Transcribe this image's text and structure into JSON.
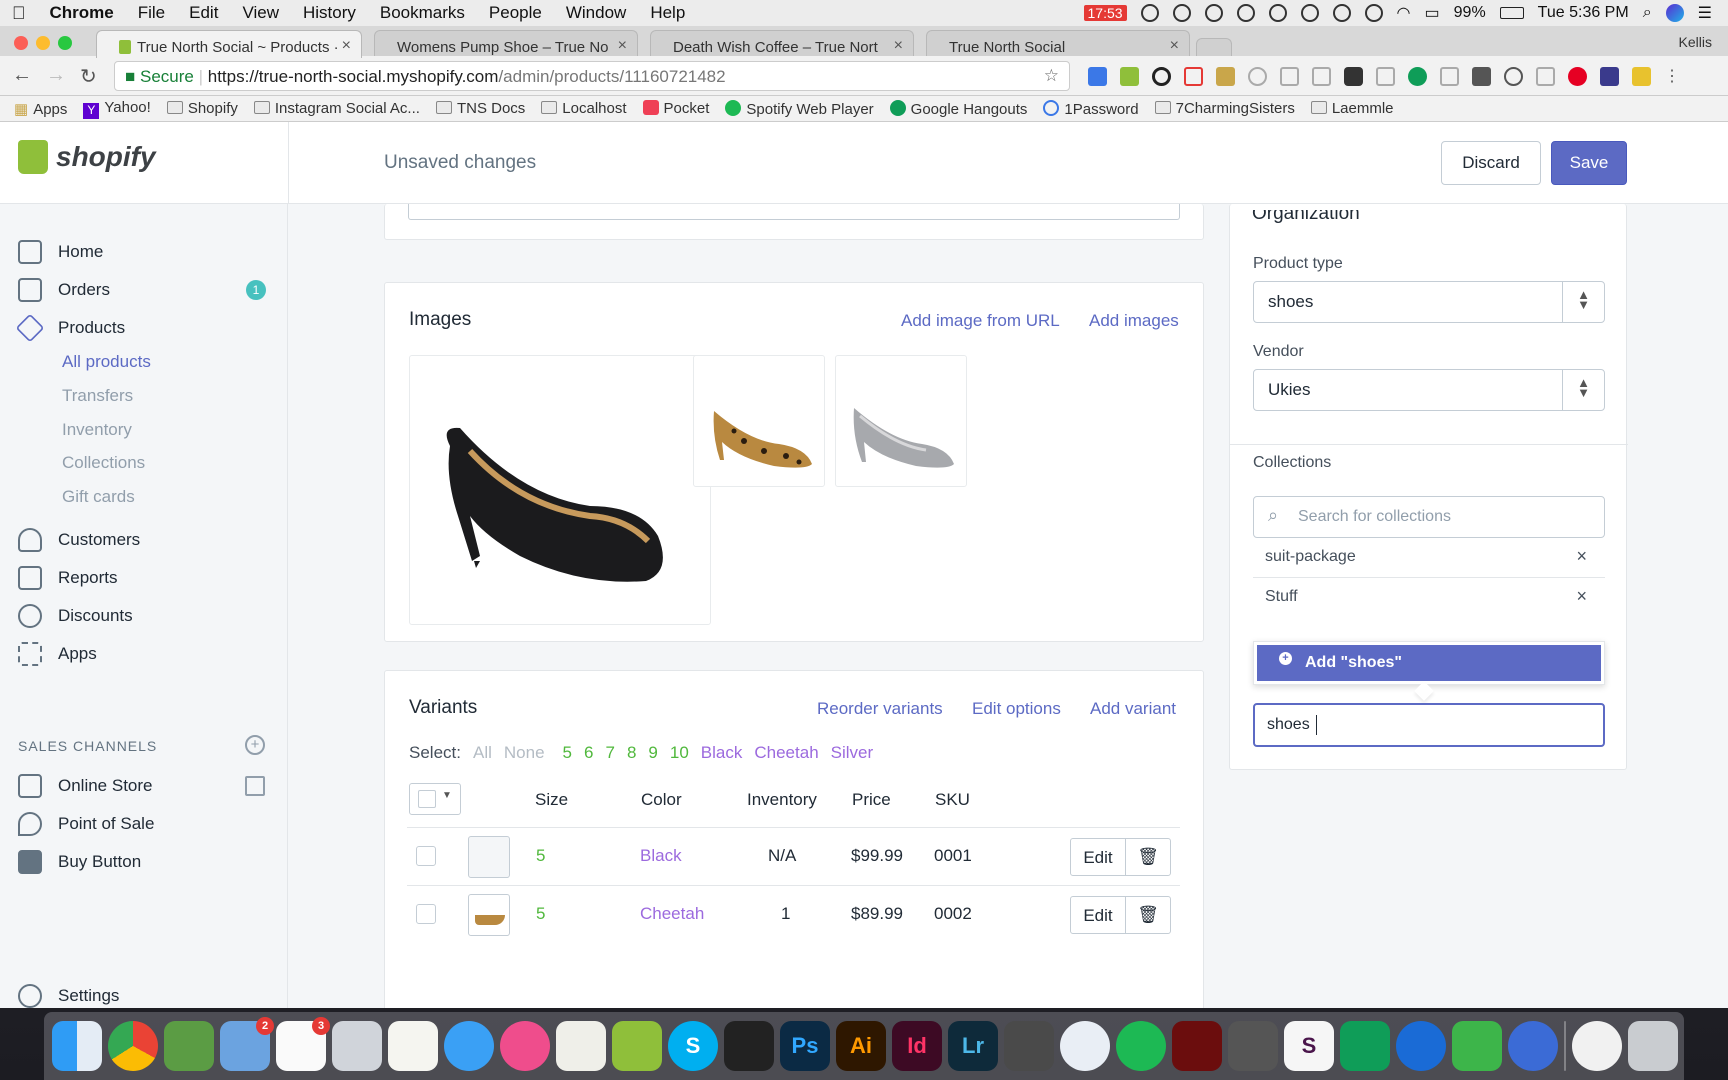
{
  "menubar": {
    "app": "Chrome",
    "menus": [
      "File",
      "Edit",
      "View",
      "History",
      "Bookmarks",
      "People",
      "Window",
      "Help"
    ],
    "record_time": "17:53",
    "battery": "99%",
    "clock": "Tue 5:36 PM",
    "user": "Kellis"
  },
  "tabs": [
    {
      "title": "True North Social ~ Products ·"
    },
    {
      "title": "Womens Pump Shoe – True No"
    },
    {
      "title": "Death Wish Coffee – True Nort"
    },
    {
      "title": "True North Social"
    }
  ],
  "address": {
    "secure_label": "Secure",
    "host": "https://true-north-social.myshopify.com",
    "path": "/admin/products/11160721482"
  },
  "bookmarks": [
    "Apps",
    "Yahoo!",
    "Shopify",
    "Instagram Social Ac...",
    "TNS Docs",
    "Localhost",
    "Pocket",
    "Spotify Web Player",
    "Google Hangouts",
    "1Password",
    "7CharmingSisters",
    "Laemmle"
  ],
  "brand": "shopify",
  "header": {
    "status": "Unsaved changes",
    "discard": "Discard",
    "save": "Save"
  },
  "nav": {
    "home": "Home",
    "orders": "Orders",
    "orders_badge": "1",
    "products": "Products",
    "all_products": "All products",
    "transfers": "Transfers",
    "inventory": "Inventory",
    "collections": "Collections",
    "gift_cards": "Gift cards",
    "customers": "Customers",
    "reports": "Reports",
    "discounts": "Discounts",
    "apps": "Apps",
    "sales_channels": "SALES CHANNELS",
    "online_store": "Online Store",
    "point_of_sale": "Point of Sale",
    "buy_button": "Buy Button",
    "settings": "Settings"
  },
  "images_card": {
    "title": "Images",
    "add_from_url": "Add image from URL",
    "add_images": "Add images"
  },
  "variants_card": {
    "title": "Variants",
    "reorder": "Reorder variants",
    "edit_options": "Edit options",
    "add_variant": "Add variant",
    "select_label": "Select:",
    "select_all": "All",
    "select_none": "None",
    "select_sizes": [
      "5",
      "6",
      "7",
      "8",
      "9",
      "10"
    ],
    "select_colors": [
      "Black",
      "Cheetah",
      "Silver"
    ],
    "columns": [
      "Size",
      "Color",
      "Inventory",
      "Price",
      "SKU"
    ],
    "rows": [
      {
        "size": "5",
        "color": "Black",
        "inventory": "N/A",
        "price": "$99.99",
        "sku": "0001",
        "edit": "Edit"
      },
      {
        "size": "5",
        "color": "Cheetah",
        "inventory": "1",
        "price": "$89.99",
        "sku": "0002",
        "edit": "Edit"
      }
    ]
  },
  "organization": {
    "title": "Organization",
    "product_type_label": "Product type",
    "product_type": "shoes",
    "vendor_label": "Vendor",
    "vendor": "Ukies",
    "collections_label": "Collections",
    "search_placeholder": "Search for collections",
    "collections": [
      "suit-package",
      "Stuff"
    ],
    "add_suggestion": "Add \"shoes\"",
    "input_value": "shoes"
  },
  "dock": {
    "icons": [
      "finder",
      "chrome",
      "evernote",
      "preview",
      "calendar",
      "photos",
      "notes",
      "messages",
      "itunes",
      "textedit",
      "shopify",
      "skype",
      "activity",
      "Ps",
      "Ai",
      "Id",
      "Lr",
      "sublime",
      "safari",
      "spotify",
      "acrobat",
      "calculator",
      "slack",
      "hangouts",
      "1password",
      "upwork",
      "reeder",
      "1password-mini",
      "trash"
    ],
    "labels": {
      "Ps": "Ps",
      "Ai": "Ai",
      "Id": "Id",
      "Lr": "Lr",
      "skype": "S",
      "slack": "S"
    },
    "badges": {
      "preview": "2",
      "calendar": "3"
    }
  },
  "colors": {
    "accent": "#5c6ac4",
    "link_color": "#5c6ac4",
    "teal": "#47c1bf",
    "green_size": "#50b83c",
    "purple_color": "#9c6ade"
  }
}
